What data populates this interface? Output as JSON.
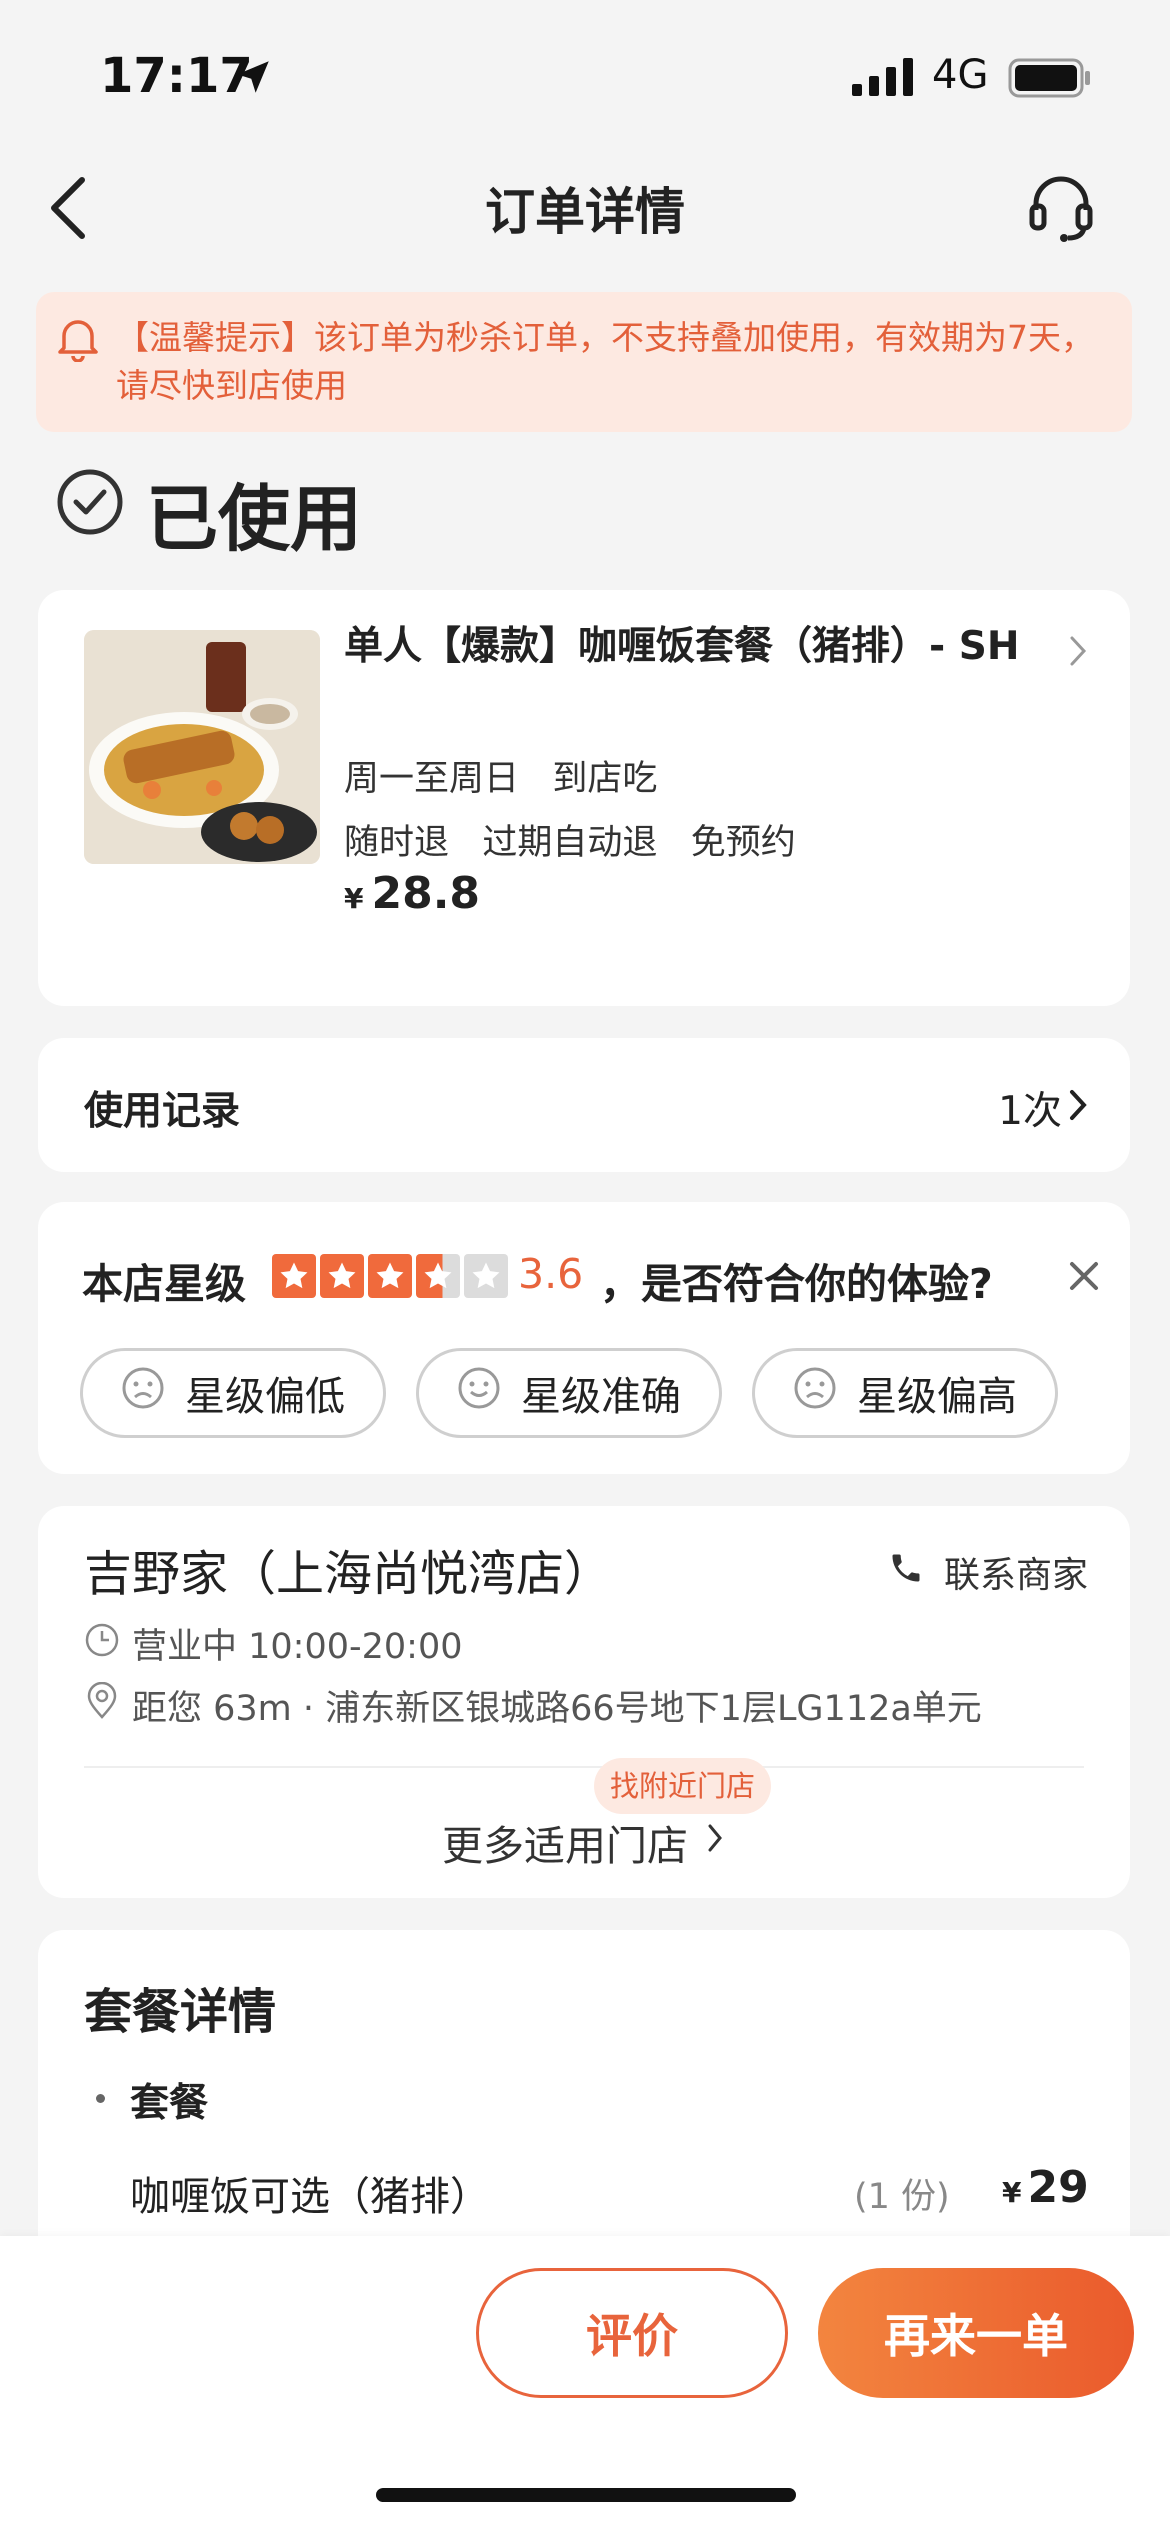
{
  "status_bar": {
    "time": "17:17",
    "network": "4G"
  },
  "nav": {
    "title": "订单详情"
  },
  "notice": {
    "text": "【温馨提示】该订单为秒杀订单，不支持叠加使用，有效期为7天，请尽快到店使用"
  },
  "order_status": {
    "label": "已使用"
  },
  "product": {
    "title": "单人【爆款】咖喱饭套餐（猪排）- SH",
    "tags_line1": "周一至周日   到店吃",
    "tags_line2": "随时退   过期自动退   免预约",
    "currency": "¥",
    "price": "28.8"
  },
  "usage_record": {
    "label": "使用记录",
    "count": "1次"
  },
  "rating": {
    "label": "本店星级",
    "score": 3.6,
    "score_text": "3.6",
    "question": "，是否符合你的体验?",
    "accent_color": "#f06a3c",
    "options": [
      {
        "label": "星级偏低",
        "icon": "sad-face-icon"
      },
      {
        "label": "星级准确",
        "icon": "smile-face-icon"
      },
      {
        "label": "星级偏高",
        "icon": "sad-face-icon"
      }
    ]
  },
  "store": {
    "name": "吉野家（上海尚悦湾店）",
    "contact_label": "联系商家",
    "hours": "营业中 10:00-20:00",
    "address": "距您 63m · 浦东新区银城路66号地下1层LG112a单元",
    "nearby_badge": "找附近门店",
    "more_stores": "更多适用门店"
  },
  "package": {
    "title": "套餐详情",
    "section": "套餐",
    "items": [
      {
        "name": "咖喱饭可选（猪排）",
        "qty": "(1 份)",
        "currency": "¥",
        "price": "29"
      }
    ]
  },
  "actions": {
    "review": "评价",
    "reorder": "再来一单"
  }
}
